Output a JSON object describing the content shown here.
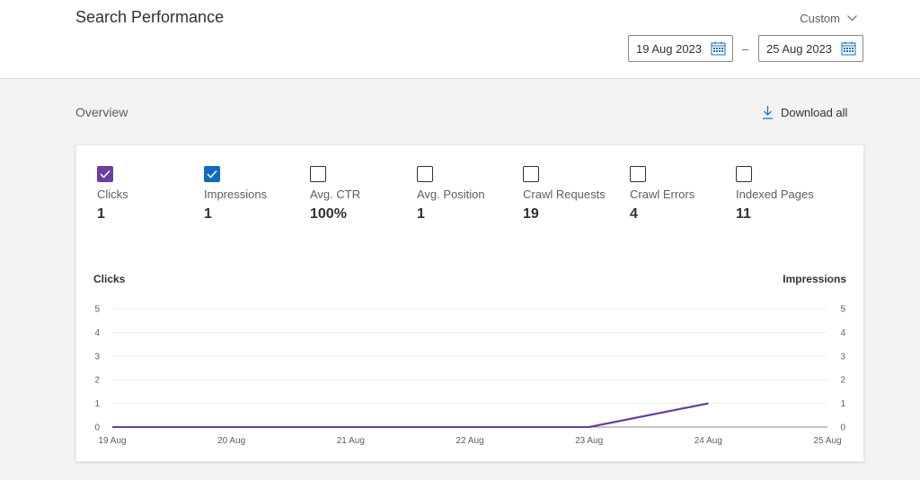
{
  "header": {
    "title": "Search Performance",
    "range_label": "Custom",
    "start_date": "19 Aug 2023",
    "end_date": "25 Aug 2023",
    "separator": "–"
  },
  "overview": {
    "title": "Overview",
    "download_label": "Download all"
  },
  "metrics": [
    {
      "label": "Clicks",
      "value": "1",
      "checked": true,
      "color": "#6b3fa0"
    },
    {
      "label": "Impressions",
      "value": "1",
      "checked": true,
      "color": "#0f6cbd"
    },
    {
      "label": "Avg. CTR",
      "value": "100%",
      "checked": false
    },
    {
      "label": "Avg. Position",
      "value": "1",
      "checked": false
    },
    {
      "label": "Crawl Requests",
      "value": "19",
      "checked": false
    },
    {
      "label": "Crawl Errors",
      "value": "4",
      "checked": false
    },
    {
      "label": "Indexed Pages",
      "value": "11",
      "checked": false
    }
  ],
  "chart_data": {
    "type": "line",
    "categories": [
      "19 Aug",
      "20 Aug",
      "21 Aug",
      "22 Aug",
      "23 Aug",
      "24 Aug",
      "25 Aug"
    ],
    "series": [
      {
        "name": "Clicks",
        "values": [
          0,
          0,
          0,
          0,
          0,
          1,
          null
        ],
        "color": "#6b3fa0"
      },
      {
        "name": "Impressions",
        "values": [
          0,
          0,
          0,
          0,
          0,
          1,
          null
        ],
        "color": "#0f6cbd"
      }
    ],
    "ylabel_left": "Clicks",
    "ylabel_right": "Impressions",
    "ylim": [
      0,
      5
    ],
    "yticks": [
      0,
      1,
      2,
      3,
      4,
      5
    ],
    "grid": true
  }
}
